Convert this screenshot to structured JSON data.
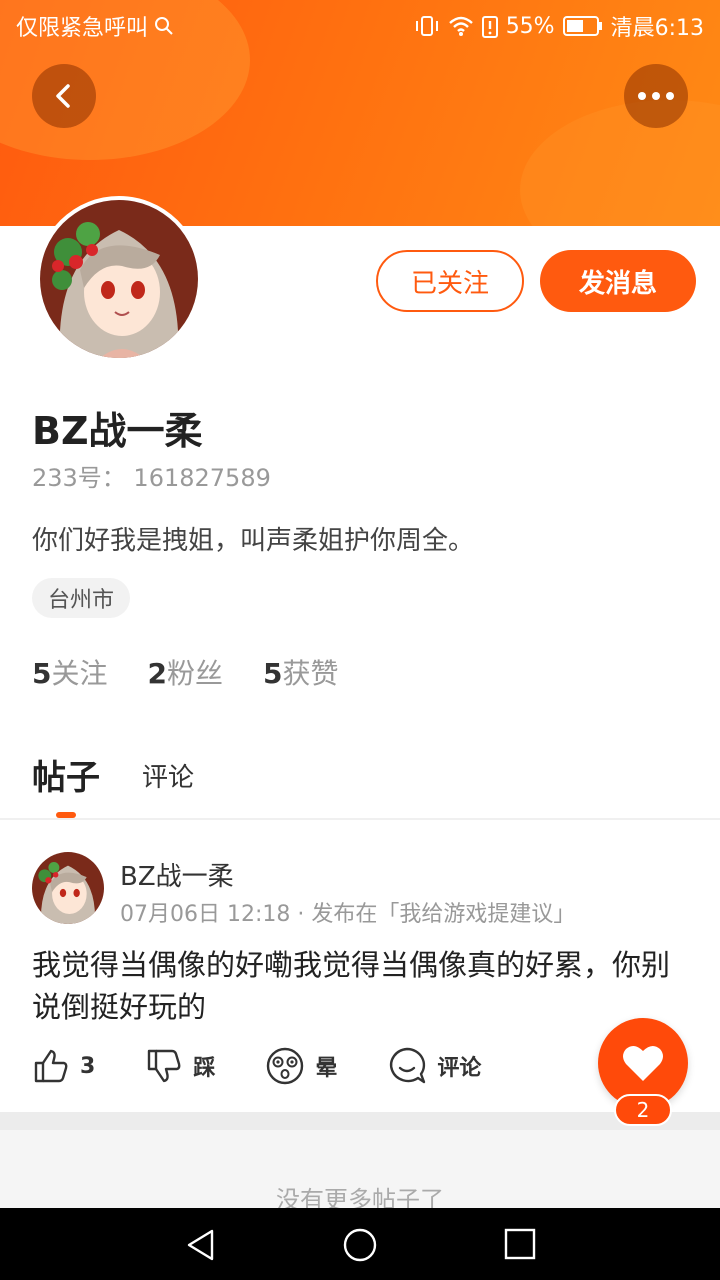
{
  "status_bar": {
    "left_text": "仅限紧急呼叫",
    "battery": "55%",
    "time": "清晨6:13"
  },
  "header": {
    "back_icon": "chevron-left-icon",
    "more_icon": "more-dots-icon"
  },
  "profile": {
    "follow_label": "已关注",
    "message_label": "发消息",
    "name": "BZ战一柔",
    "uid": "233号： 161827589",
    "bio": "你们好我是拽姐，叫声柔姐护你周全。",
    "location": "台州市",
    "stats": [
      {
        "count": "5",
        "label": "关注"
      },
      {
        "count": "2",
        "label": "粉丝"
      },
      {
        "count": "5",
        "label": "获赞"
      }
    ]
  },
  "tabs": [
    {
      "label": "帖子"
    },
    {
      "label": "评论"
    }
  ],
  "post": {
    "author": "BZ战一柔",
    "meta": "07月06日 12:18 · 发布在「我给游戏提建议」",
    "body": "我觉得当偶像的好嘞我觉得当偶像真的好累，你别说倒挺好玩的",
    "actions": {
      "like": "3",
      "dislike": "踩",
      "dizzy": "晕",
      "comment": "评论"
    }
  },
  "fab": {
    "icon": "heart-icon",
    "count": "2"
  },
  "footer": {
    "no_more": "没有更多帖子了"
  },
  "colors": {
    "accent": "#ff5a0f",
    "banner_start": "#ff5a0f",
    "banner_end": "#ff8a15"
  }
}
